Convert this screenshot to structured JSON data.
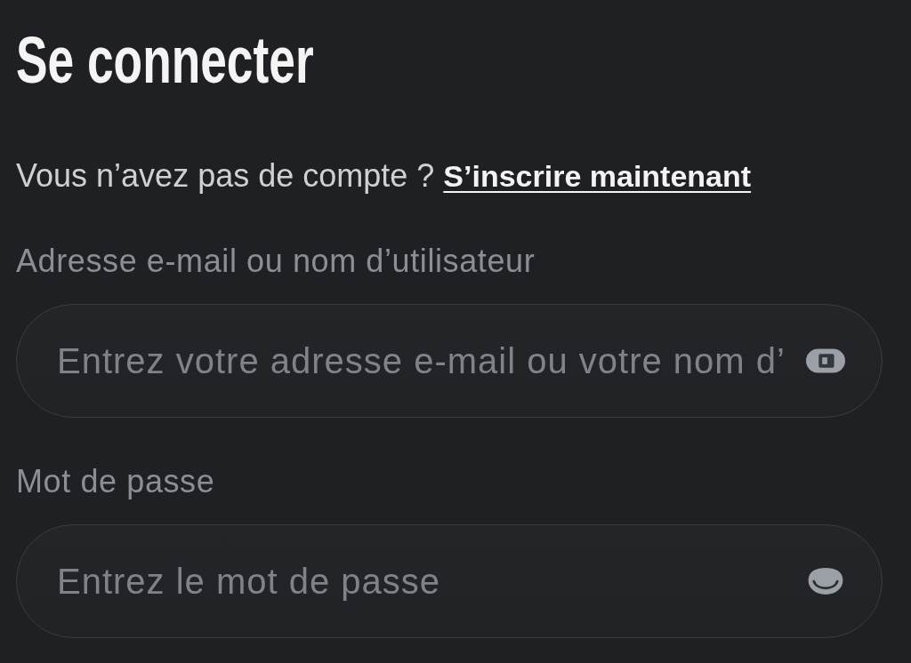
{
  "title": "Se connecter",
  "signup_prompt": {
    "text": "Vous n’avez pas de compte ?",
    "link": "S’inscrire maintenant"
  },
  "fields": [
    {
      "kind": "text",
      "label": "Adresse e-mail ou nom d’utilisateur",
      "placeholder": "Entrez votre adresse e-mail ou votre nom d’"
    },
    {
      "kind": "password",
      "label": "Mot de passe",
      "placeholder": "Entrez le mot de passe"
    }
  ]
}
